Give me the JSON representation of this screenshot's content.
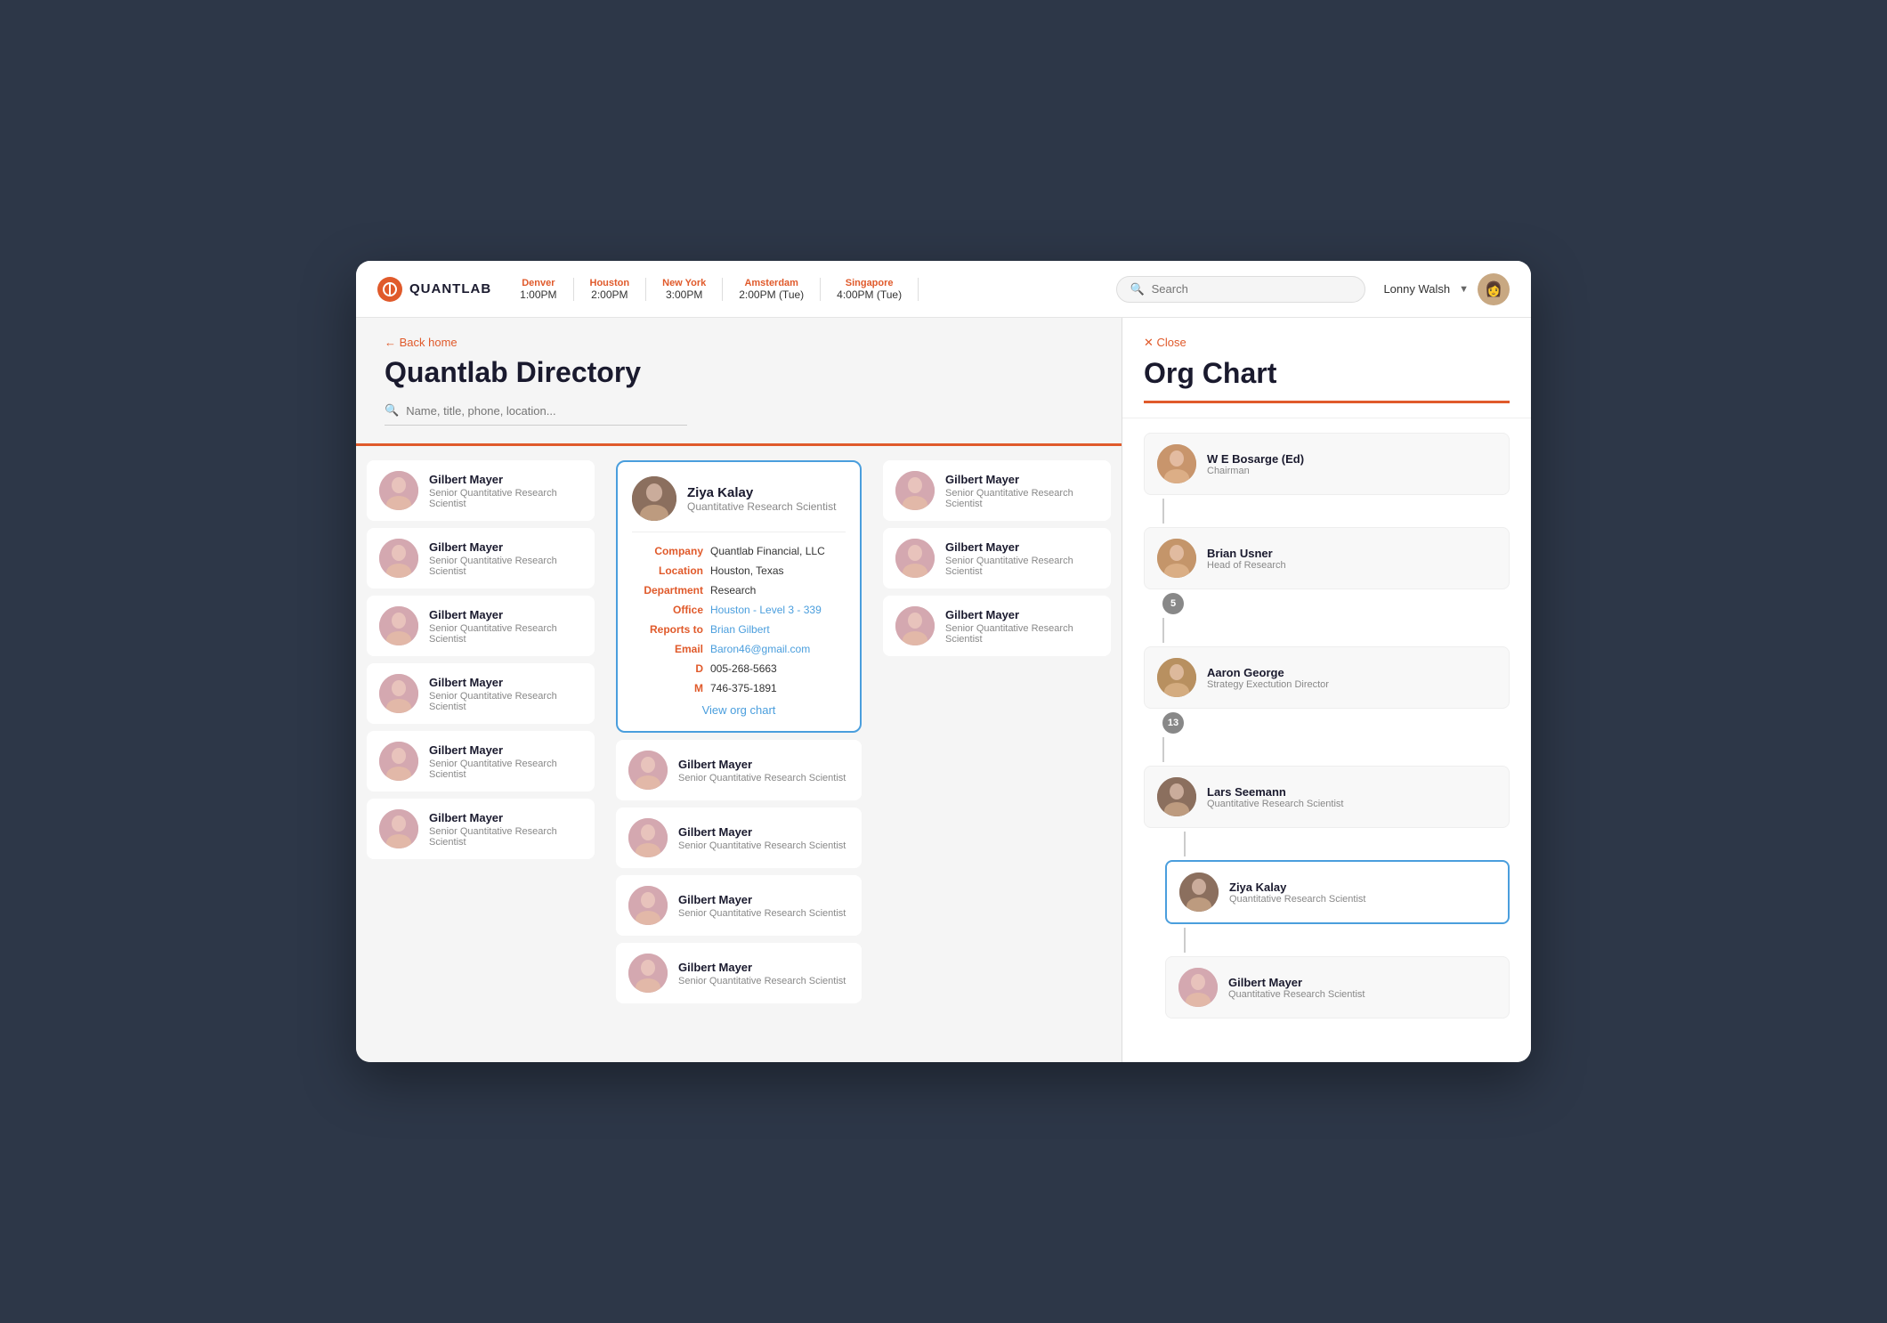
{
  "header": {
    "logo_letter": "Q",
    "logo_text": "QUANTLAB",
    "timezones": [
      {
        "city": "Denver",
        "time": "1:00PM"
      },
      {
        "city": "Houston",
        "time": "2:00PM"
      },
      {
        "city": "New York",
        "time": "3:00PM"
      },
      {
        "city": "Amsterdam",
        "time": "2:00PM (Tue)"
      },
      {
        "city": "Singapore",
        "time": "4:00PM (Tue)"
      }
    ],
    "search_placeholder": "Search",
    "user_name": "Lonny Walsh"
  },
  "directory": {
    "back_label": "← Back home",
    "title": "Quantlab Directory",
    "search_placeholder": "Name, title, phone, location...",
    "col1_people": [
      {
        "name": "Gilbert Mayer",
        "title": "Senior Quantitative Research Scientist",
        "face": "face-3"
      },
      {
        "name": "Gilbert Mayer",
        "title": "Senior Quantitative Research Scientist",
        "face": "face-3"
      },
      {
        "name": "Gilbert Mayer",
        "title": "Senior Quantitative Research Scientist",
        "face": "face-3"
      },
      {
        "name": "Gilbert Mayer",
        "title": "Senior Quantitative Research Scientist",
        "face": "face-3"
      },
      {
        "name": "Gilbert Mayer",
        "title": "Senior Quantitative Research Scientist",
        "face": "face-3"
      },
      {
        "name": "Gilbert Mayer",
        "title": "Senior Quantitative Research Scientist",
        "face": "face-3"
      }
    ],
    "detail": {
      "name": "Ziya Kalay",
      "title": "Quantitative Research Scientist",
      "company_label": "Company",
      "company": "Quantlab Financial, LLC",
      "location_label": "Location",
      "location": "Houston, Texas",
      "department_label": "Department",
      "department": "Research",
      "office_label": "Office",
      "office": "Houston - Level 3 - 339",
      "reports_to_label": "Reports to",
      "reports_to": "Brian Gilbert",
      "email_label": "Email",
      "email": "Baron46@gmail.com",
      "d_label": "D",
      "d_phone": "005-268-5663",
      "m_label": "M",
      "m_phone": "746-375-1891",
      "view_org_label": "View org chart",
      "face": "face-2"
    },
    "col2_people": [
      {
        "name": "Gilbert Mayer",
        "title": "Senior Quantitative Research Scientist",
        "face": "face-3"
      },
      {
        "name": "Gilbert Mayer",
        "title": "Senior Quantitative Research Scientist",
        "face": "face-3"
      },
      {
        "name": "Gilbert Mayer",
        "title": "Senior Quantitative Research Scientist",
        "face": "face-3"
      },
      {
        "name": "Gilbert Mayer",
        "title": "Senior Quantitative Research Scientist",
        "face": "face-3"
      }
    ],
    "col3_people": [
      {
        "name": "Gilbert Mayer",
        "title": "Senior Quantitative Research Scientist",
        "face": "face-3"
      },
      {
        "name": "Gilbert Mayer",
        "title": "Senior Quantitative Research Scientist",
        "face": "face-3"
      },
      {
        "name": "Gilbert Mayer",
        "title": "Senior Quantitative Research Scientist",
        "face": "face-3"
      }
    ]
  },
  "orgchart": {
    "close_label": "✕ Close",
    "title": "Org Chart",
    "nodes": [
      {
        "id": "bosarge",
        "name": "W E Bosarge (Ed)",
        "role": "Chairman",
        "face": "face-1",
        "indent": 0
      },
      {
        "id": "usner",
        "name": "Brian Usner",
        "role": "Head of Research",
        "face": "face-4",
        "indent": 0
      },
      {
        "id": "expand5",
        "badge": "5",
        "indent": 0
      },
      {
        "id": "george",
        "name": "Aaron George",
        "role": "Strategy Exectution Director",
        "face": "face-5",
        "indent": 0
      },
      {
        "id": "expand13",
        "badge": "13",
        "indent": 0
      },
      {
        "id": "seemann",
        "name": "Lars Seemann",
        "role": "Quantitative Research Scientist",
        "face": "face-2",
        "indent": 0
      },
      {
        "id": "kalay",
        "name": "Ziya Kalay",
        "role": "Quantitative Research Scientist",
        "face": "face-2",
        "selected": true,
        "indent": 1
      },
      {
        "id": "gilbert_bottom",
        "name": "Gilbert Mayer",
        "role": "Quantitative Research Scientist",
        "face": "face-3",
        "indent": 1
      }
    ]
  }
}
